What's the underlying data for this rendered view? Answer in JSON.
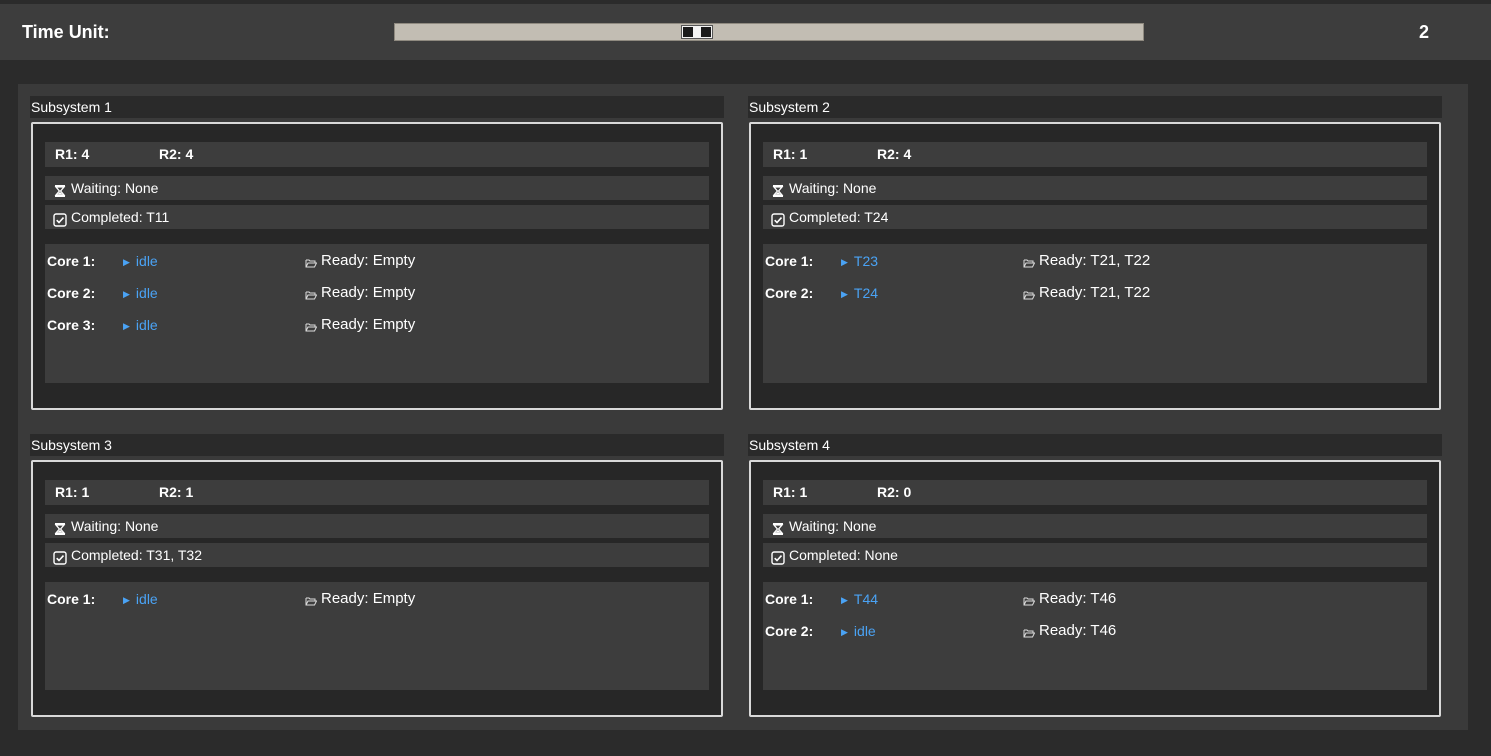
{
  "header": {
    "label": "Time Unit:",
    "value": "2",
    "slider_fraction": 0.4
  },
  "subsystems": [
    {
      "title": "Subsystem 1",
      "r1": "R1: 4",
      "r2": "R2: 4",
      "waiting": "Waiting: None",
      "completed": "Completed: T11",
      "cores": [
        {
          "label": "Core 1:",
          "task": "idle",
          "ready": "Ready: Empty"
        },
        {
          "label": "Core 2:",
          "task": "idle",
          "ready": "Ready: Empty"
        },
        {
          "label": "Core 3:",
          "task": "idle",
          "ready": "Ready: Empty"
        }
      ]
    },
    {
      "title": "Subsystem 2",
      "r1": "R1: 1",
      "r2": "R2: 4",
      "waiting": "Waiting: None",
      "completed": "Completed: T24",
      "cores": [
        {
          "label": "Core 1:",
          "task": "T23",
          "ready": "Ready: T21, T22"
        },
        {
          "label": "Core 2:",
          "task": "T24",
          "ready": "Ready: T21, T22"
        }
      ]
    },
    {
      "title": "Subsystem 3",
      "r1": "R1: 1",
      "r2": "R2: 1",
      "waiting": "Waiting: None",
      "completed": "Completed: T31, T32",
      "cores": [
        {
          "label": "Core 1:",
          "task": "idle",
          "ready": "Ready: Empty"
        }
      ]
    },
    {
      "title": "Subsystem 4",
      "r1": "R1: 1",
      "r2": "R2: 0",
      "waiting": "Waiting: None",
      "completed": "Completed: None",
      "cores": [
        {
          "label": "Core 1:",
          "task": "T44",
          "ready": "Ready: T46"
        },
        {
          "label": "Core 2:",
          "task": "idle",
          "ready": "Ready: T46"
        }
      ]
    }
  ],
  "icons": {
    "waiting": "hourglass-icon",
    "completed": "checkbox-checked-icon",
    "running": "play-arrow-icon",
    "ready": "folder-open-icon"
  },
  "colors": {
    "task": "#4aa3f5",
    "background": "#2b2b2b",
    "panel": "#3d3d3d",
    "border": "#d9d9d9"
  }
}
